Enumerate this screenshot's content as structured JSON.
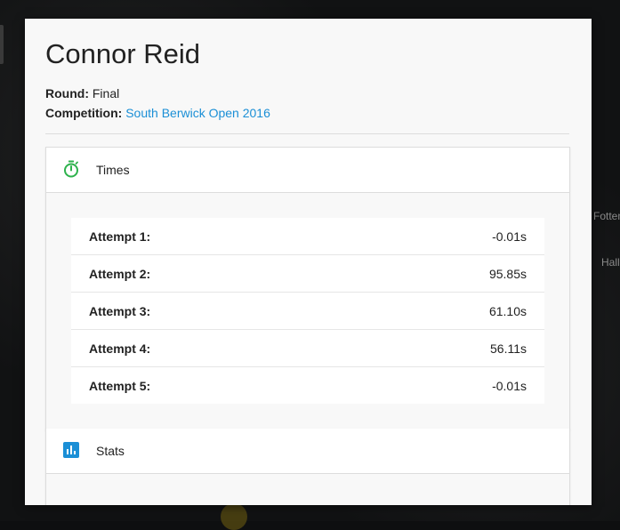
{
  "player": {
    "name": "Connor Reid",
    "round_label": "Round:",
    "round_value": "Final",
    "competition_label": "Competition:",
    "competition_value": "South Berwick Open 2016"
  },
  "background": {
    "text1": "Fotten",
    "text2": "Hall"
  },
  "times": {
    "header": "Times",
    "icon": "stopwatch-icon",
    "icon_color": "#2db24c",
    "attempts": [
      {
        "label": "Attempt 1:",
        "value": "-0.01s"
      },
      {
        "label": "Attempt 2:",
        "value": "95.85s"
      },
      {
        "label": "Attempt 3:",
        "value": "61.10s"
      },
      {
        "label": "Attempt 4:",
        "value": "56.11s"
      },
      {
        "label": "Attempt 5:",
        "value": "-0.01s"
      }
    ]
  },
  "stats": {
    "header": "Stats",
    "icon": "bar-chart-icon",
    "icon_color": "#1b8fd6"
  },
  "colors": {
    "link": "#1b8fd6"
  }
}
